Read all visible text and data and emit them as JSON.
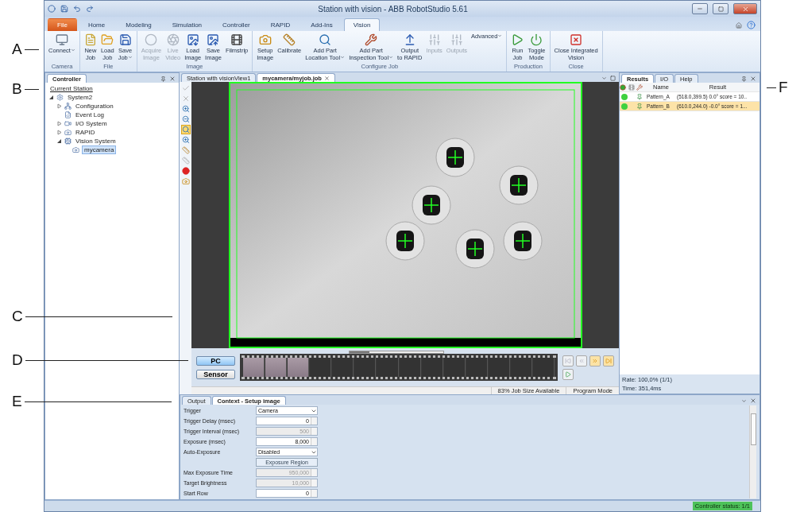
{
  "callouts": [
    {
      "label": "A",
      "kind": "left"
    },
    {
      "label": "B",
      "kind": "left"
    },
    {
      "label": "C",
      "kind": "left"
    },
    {
      "label": "D",
      "kind": "left"
    },
    {
      "label": "E",
      "kind": "left"
    },
    {
      "label": "F",
      "kind": "right"
    }
  ],
  "window": {
    "title": "Station with vision - ABB RobotStudio 5.61"
  },
  "ribbon_tabs": [
    {
      "label": "File",
      "selected": false,
      "kind": "file"
    },
    {
      "label": "Home",
      "selected": false,
      "kind": "tab"
    },
    {
      "label": "Modeling",
      "selected": false,
      "kind": "tab"
    },
    {
      "label": "Simulation",
      "selected": false,
      "kind": "tab"
    },
    {
      "label": "Controller",
      "selected": false,
      "kind": "tab"
    },
    {
      "label": "RAPID",
      "selected": false,
      "kind": "tab"
    },
    {
      "label": "Add-Ins",
      "selected": false,
      "kind": "tab"
    },
    {
      "label": "Vision",
      "selected": true,
      "kind": "tab"
    }
  ],
  "ribbon_groups": [
    {
      "label": "Camera",
      "buttons": [
        {
          "label": "Connect",
          "disabled": false,
          "dropdown": true
        }
      ]
    },
    {
      "label": "File",
      "buttons": [
        {
          "label": "New\nJob",
          "disabled": false,
          "dropdown": false
        },
        {
          "label": "Load\nJob",
          "disabled": false,
          "dropdown": false
        },
        {
          "label": "Save\nJob",
          "disabled": false,
          "dropdown": true
        }
      ]
    },
    {
      "label": "Image",
      "buttons": [
        {
          "label": "Acquire\nImage",
          "disabled": true,
          "dropdown": false
        },
        {
          "label": "Live\nVideo",
          "disabled": true,
          "dropdown": false
        },
        {
          "label": "Load\nImage",
          "disabled": false,
          "dropdown": false
        },
        {
          "label": "Save\nImage",
          "disabled": false,
          "dropdown": false
        },
        {
          "label": "Filmstrip",
          "disabled": false,
          "dropdown": false
        }
      ]
    },
    {
      "label": "Configure Job",
      "buttons": [
        {
          "label": "Setup\nImage",
          "disabled": false,
          "dropdown": false
        },
        {
          "label": "Calibrate",
          "disabled": false,
          "dropdown": false
        },
        {
          "label": "Add Part\nLocation Tool",
          "disabled": false,
          "dropdown": true
        },
        {
          "label": "Add Part\nInspection Tool",
          "disabled": false,
          "dropdown": true
        },
        {
          "label": "Output\nto RAPID",
          "disabled": false,
          "dropdown": false
        },
        {
          "label": "Inputs",
          "disabled": true,
          "dropdown": false
        },
        {
          "label": "Outputs",
          "disabled": true,
          "dropdown": false
        },
        {
          "label": "Advanced",
          "disabled": false,
          "dropdown": true
        }
      ]
    },
    {
      "label": "Production",
      "buttons": [
        {
          "label": "Run\nJob",
          "disabled": false,
          "dropdown": false
        },
        {
          "label": "Toggle\nMode",
          "disabled": false,
          "dropdown": false
        }
      ]
    },
    {
      "label": "Close",
      "buttons": [
        {
          "label": "Close Integrated\nVision",
          "disabled": false,
          "dropdown": false
        }
      ]
    }
  ],
  "controller_panel": {
    "title": "Controller",
    "tree": [
      {
        "label": "Current Station",
        "kind": "link",
        "selected": false
      },
      {
        "label": "System2",
        "kind": "node",
        "expanded": true,
        "selected": false,
        "children": [
          {
            "label": "Configuration",
            "kind": "node",
            "expanded": false,
            "selected": false
          },
          {
            "label": "Event Log",
            "kind": "leaf",
            "selected": false
          },
          {
            "label": "I/O System",
            "kind": "node",
            "expanded": false,
            "selected": false
          },
          {
            "label": "RAPID",
            "kind": "node",
            "expanded": false,
            "selected": false
          },
          {
            "label": "Vision System",
            "kind": "node",
            "expanded": true,
            "selected": false,
            "children": [
              {
                "label": "mycamera",
                "kind": "leaf",
                "selected": true
              }
            ]
          }
        ]
      }
    ]
  },
  "document_tabs": [
    {
      "label": "Station with visionView1",
      "selected": false
    },
    {
      "label": "mycamera/myjob.job",
      "selected": true
    }
  ],
  "filmstrip": {
    "sources": [
      {
        "label": "PC",
        "selected": true
      },
      {
        "label": "Sensor",
        "selected": false
      }
    ],
    "frames": [
      {
        "kind": "image"
      },
      {
        "kind": "image"
      },
      {
        "kind": "image"
      },
      {
        "kind": "empty"
      },
      {
        "kind": "empty"
      },
      {
        "kind": "empty"
      },
      {
        "kind": "empty"
      },
      {
        "kind": "empty"
      },
      {
        "kind": "empty"
      },
      {
        "kind": "empty"
      },
      {
        "kind": "empty"
      },
      {
        "kind": "empty"
      },
      {
        "kind": "empty"
      },
      {
        "kind": "empty"
      }
    ],
    "status": [
      "83% Job Size Available",
      "Program Mode"
    ]
  },
  "results_panel": {
    "tabs": [
      {
        "label": "Results",
        "selected": true
      },
      {
        "label": "I/O",
        "selected": false
      },
      {
        "label": "Help",
        "selected": false
      }
    ],
    "columns": [
      "Name",
      "Result"
    ],
    "rows": [
      {
        "name": "Pattern_A",
        "result": "(518.0,399.5) 0.0° score = 10..",
        "selected": false,
        "passed": true
      },
      {
        "name": "Pattern_B",
        "result": "(610.0,244.0) -0.0° score = 1...",
        "selected": true,
        "passed": true
      }
    ],
    "footer": [
      "Rate: 100,0% (1/1)",
      "Time: 351,4ms"
    ]
  },
  "context_panel": {
    "tabs": [
      {
        "label": "Output",
        "selected": false
      },
      {
        "label": "Context - Setup image",
        "selected": true
      }
    ],
    "properties": [
      {
        "label": "Trigger",
        "kind": "dropdown",
        "value": "Camera",
        "disabled": false
      },
      {
        "label": "Trigger Delay (msec)",
        "kind": "number",
        "value": "0",
        "disabled": false
      },
      {
        "label": "Trigger Interval (msec)",
        "kind": "number",
        "value": "500",
        "disabled": true
      },
      {
        "label": "Exposure (msec)",
        "kind": "number",
        "value": "8,000",
        "disabled": false
      },
      {
        "label": "Auto-Exposure",
        "kind": "dropdown",
        "value": "Disabled",
        "disabled": false
      },
      {
        "kind": "button",
        "value": "Exposure Region"
      },
      {
        "label": "Max Exposure Time",
        "kind": "number",
        "value": "950,000",
        "disabled": true
      },
      {
        "label": "Target Brightness",
        "kind": "number",
        "value": "10,000",
        "disabled": true
      },
      {
        "label": "Start Row",
        "kind": "number",
        "value": "0",
        "disabled": false
      }
    ]
  },
  "status_bar": {
    "controller_status": "Controller status: 1/1"
  }
}
